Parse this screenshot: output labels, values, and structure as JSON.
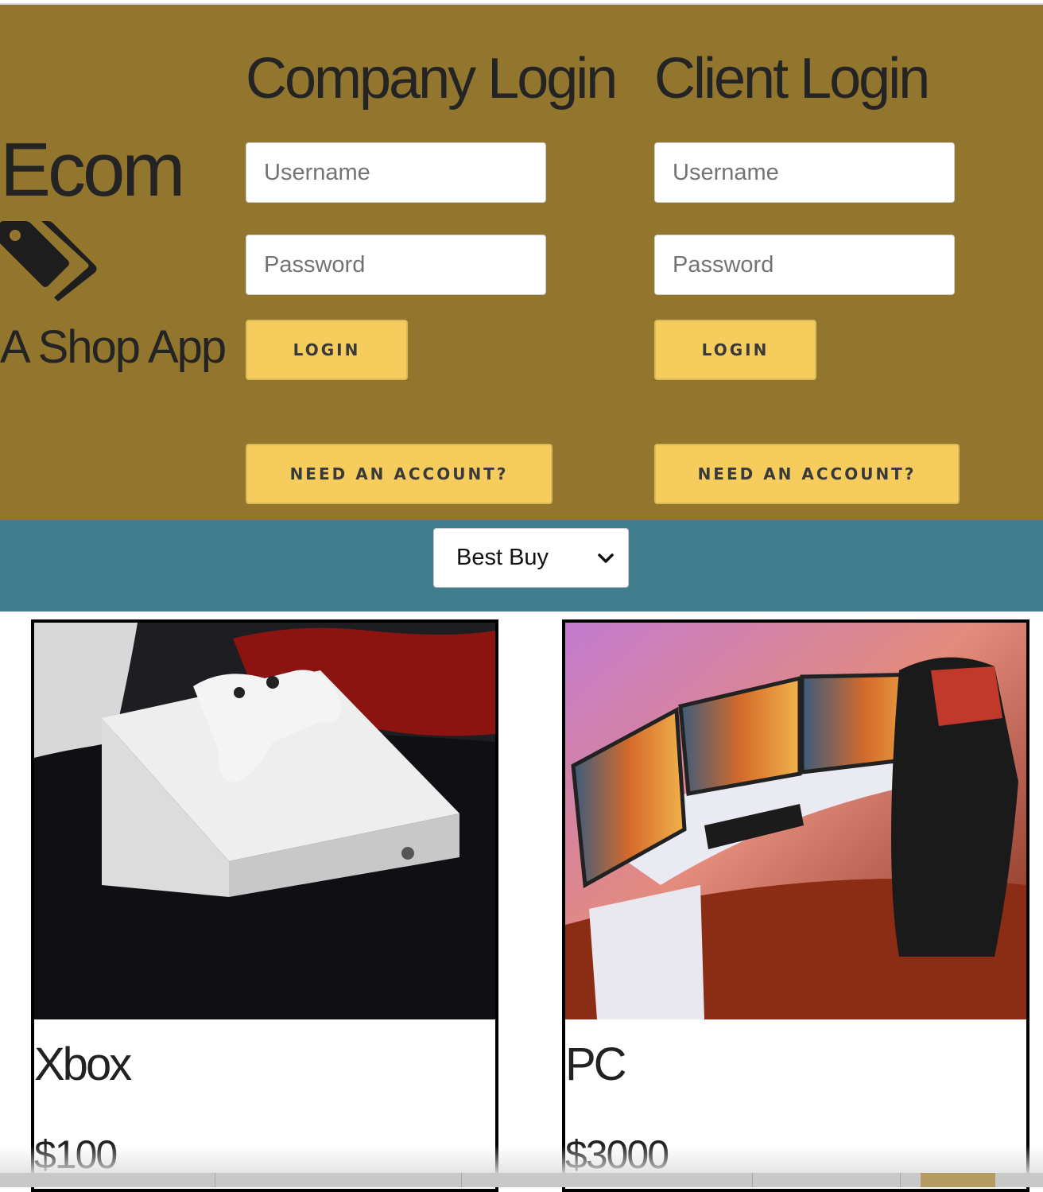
{
  "brand": {
    "title": "Ecom",
    "subtitle": "A Shop App",
    "icon": "tags-icon"
  },
  "company_login": {
    "heading": "Company Login",
    "username_placeholder": "Username",
    "password_placeholder": "Password",
    "login_label": "Login",
    "signup_label": "Need an account?"
  },
  "client_login": {
    "heading": "Client Login",
    "username_placeholder": "Username",
    "password_placeholder": "Password",
    "login_label": "Login",
    "signup_label": "Need an account?"
  },
  "store_filter": {
    "selected": "Best Buy"
  },
  "products": [
    {
      "name": "Xbox",
      "price": "$100"
    },
    {
      "name": "PC",
      "price": "$3000"
    }
  ],
  "colors": {
    "header_bg": "#93762e",
    "filter_bg": "#417d8d",
    "button_bg": "#f6cd5d"
  }
}
